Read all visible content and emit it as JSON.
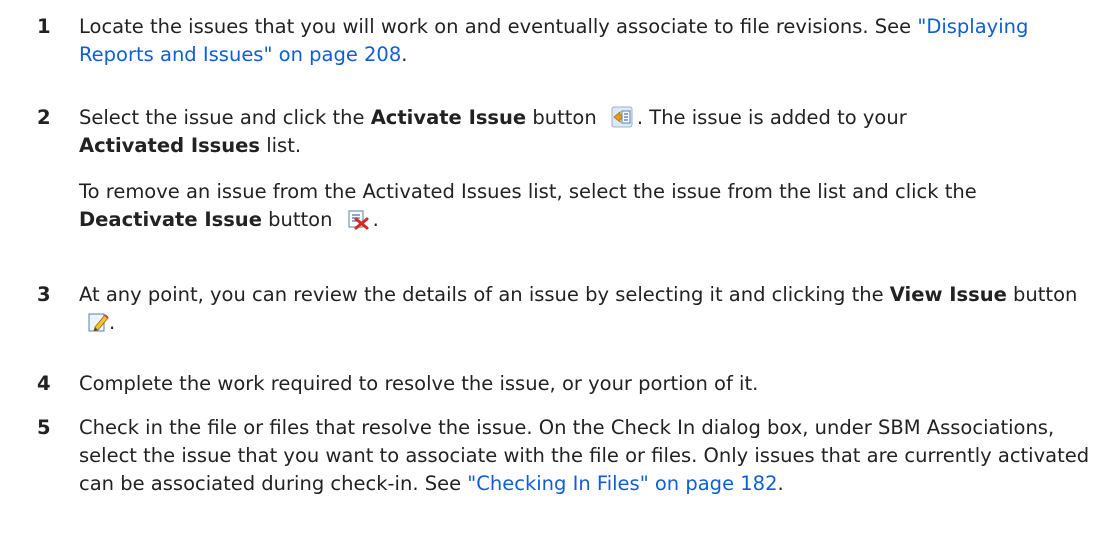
{
  "steps": [
    {
      "number": "1",
      "text_before": "Locate the issues that you will work on and eventually associate to file revisions. See ",
      "link": "\"Displaying Reports and Issues\" on page 208",
      "text_after": "."
    },
    {
      "number": "2",
      "t1": "Select the issue and click the ",
      "b1": "Activate Issue",
      "t2": " button",
      "t3": ". The issue is added to your ",
      "b2": "Activated Issues",
      "t4": " list.",
      "sub_t1": "To remove an issue from the Activated Issues list, select the issue from the list and click the ",
      "sub_b1": "Deactivate Issue",
      "sub_t2": " button",
      "sub_t3": "."
    },
    {
      "number": "3",
      "t1": "At any point, you can review the details of an issue by selecting it and clicking the ",
      "b1": "View Issue",
      "t2": " button",
      "t3": "."
    },
    {
      "number": "4",
      "text": "Complete the work required to resolve the issue, or your portion of it."
    },
    {
      "number": "5",
      "text_before": "Check in the file or files that resolve the issue. On the Check In dialog box, under SBM Associations, select the issue that you want to associate with the file or files. Only issues that are currently activated can be associated during check-in. See ",
      "link": "\"Checking In Files\" on page 182",
      "text_after": "."
    }
  ],
  "icons": {
    "activate": "activate-issue-icon",
    "deactivate": "deactivate-issue-icon",
    "view": "view-issue-icon"
  },
  "colors": {
    "link": "#0f5ed6",
    "text": "#222222"
  }
}
